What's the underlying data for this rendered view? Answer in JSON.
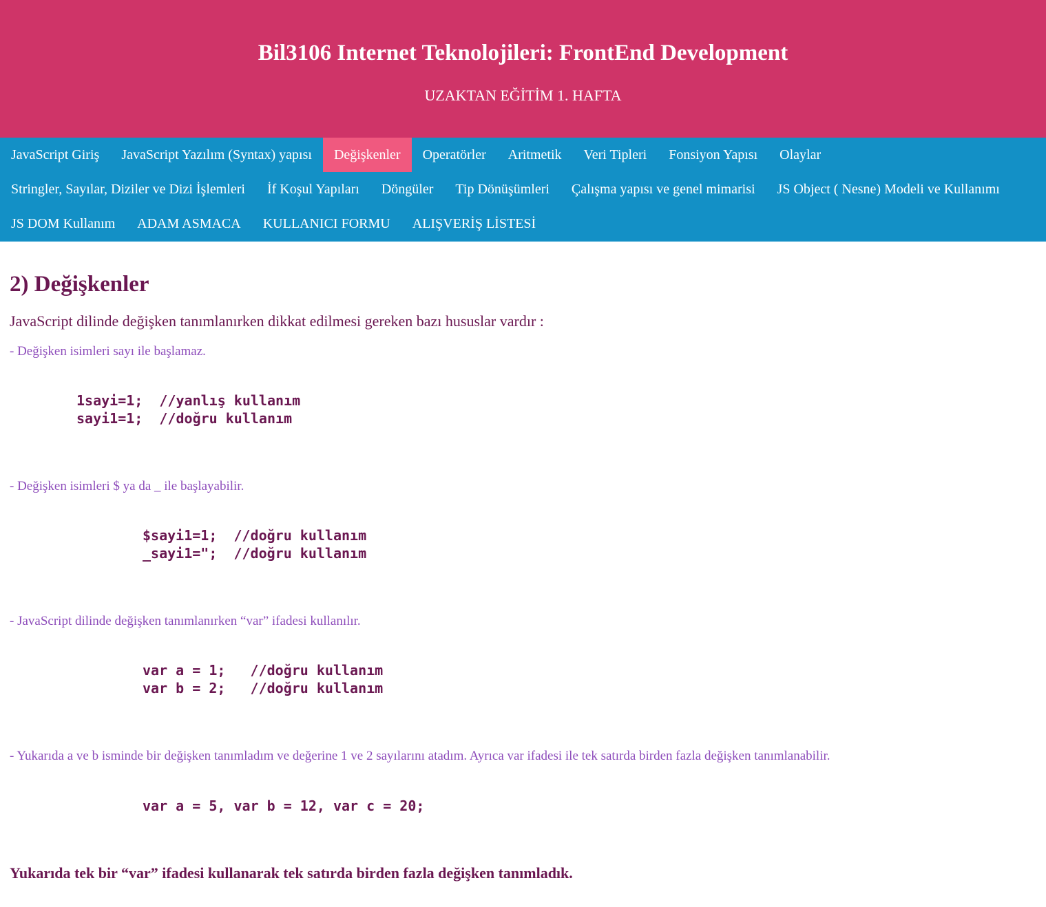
{
  "header": {
    "title": "Bil3106 Internet Teknolojileri: FrontEnd Development",
    "subtitle": "UZAKTAN EĞİTİM 1. HAFTA"
  },
  "nav": {
    "row1": [
      {
        "label": "JavaScript Giriş"
      },
      {
        "label": "JavaScript Yazılım (Syntax) yapısı"
      },
      {
        "label": "Değişkenler",
        "active": true
      },
      {
        "label": "Operatörler"
      },
      {
        "label": "Aritmetik"
      },
      {
        "label": "Veri Tipleri"
      },
      {
        "label": "Fonsiyon Yapısı"
      },
      {
        "label": "Olaylar"
      }
    ],
    "row2": [
      {
        "label": "Stringler, Sayılar, Diziler ve Dizi İşlemleri"
      },
      {
        "label": "İf Koşul Yapıları"
      },
      {
        "label": "Döngüler"
      },
      {
        "label": "Tip Dönüşümleri"
      },
      {
        "label": "Çalışma yapısı ve genel mimarisi"
      },
      {
        "label": "JS Object ( Nesne) Modeli ve Kullanımı"
      }
    ],
    "row3": [
      {
        "label": "JS DOM Kullanım"
      },
      {
        "label": "ADAM ASMACA"
      },
      {
        "label": "KULLANICI FORMU"
      },
      {
        "label": "ALIŞVERİŞ LİSTESİ"
      }
    ]
  },
  "colors": {
    "header_bg": "#cf3468",
    "nav_bg": "#1390c6",
    "nav_active_bg": "#f0597f",
    "heading_text": "#6a1751",
    "note_text": "#8e4dbb"
  },
  "content": {
    "heading": "2) Değişkenler",
    "intro": "JavaScript dilinde değişken tanımlanırken dikkat edilmesi gereken bazı hususlar vardır :",
    "note1": "- Değişken isimleri sayı ile başlamaz.",
    "code1_line1": "1sayi=1;  //yanlış kullanım",
    "code1_line2": "sayi1=1;  //doğru kullanım",
    "note2": "- Değişken isimleri $ ya da _ ile başlayabilir.",
    "code2_line1": "$sayi1=1;  //doğru kullanım",
    "code2_line2": "_sayi1=\";  //doğru kullanım",
    "note3": "- JavaScript dilinde değişken tanımlanırken “var” ifadesi kullanılır.",
    "code3_line1": "var a = 1;   //doğru kullanım",
    "code3_line2": "var b = 2;   //doğru kullanım",
    "note4": "- Yukarıda a ve b isminde bir değişken tanımladım ve değerine 1 ve 2 sayılarını atadım. Ayrıca var ifadesi ile tek satırda birden fazla değişken tanımlanabilir.",
    "code4_line1": "var a = 5, var b = 12, var c = 20;",
    "final": "Yukarıda tek bir “var” ifadesi kullanarak tek satırda birden fazla değişken tanımladık."
  }
}
